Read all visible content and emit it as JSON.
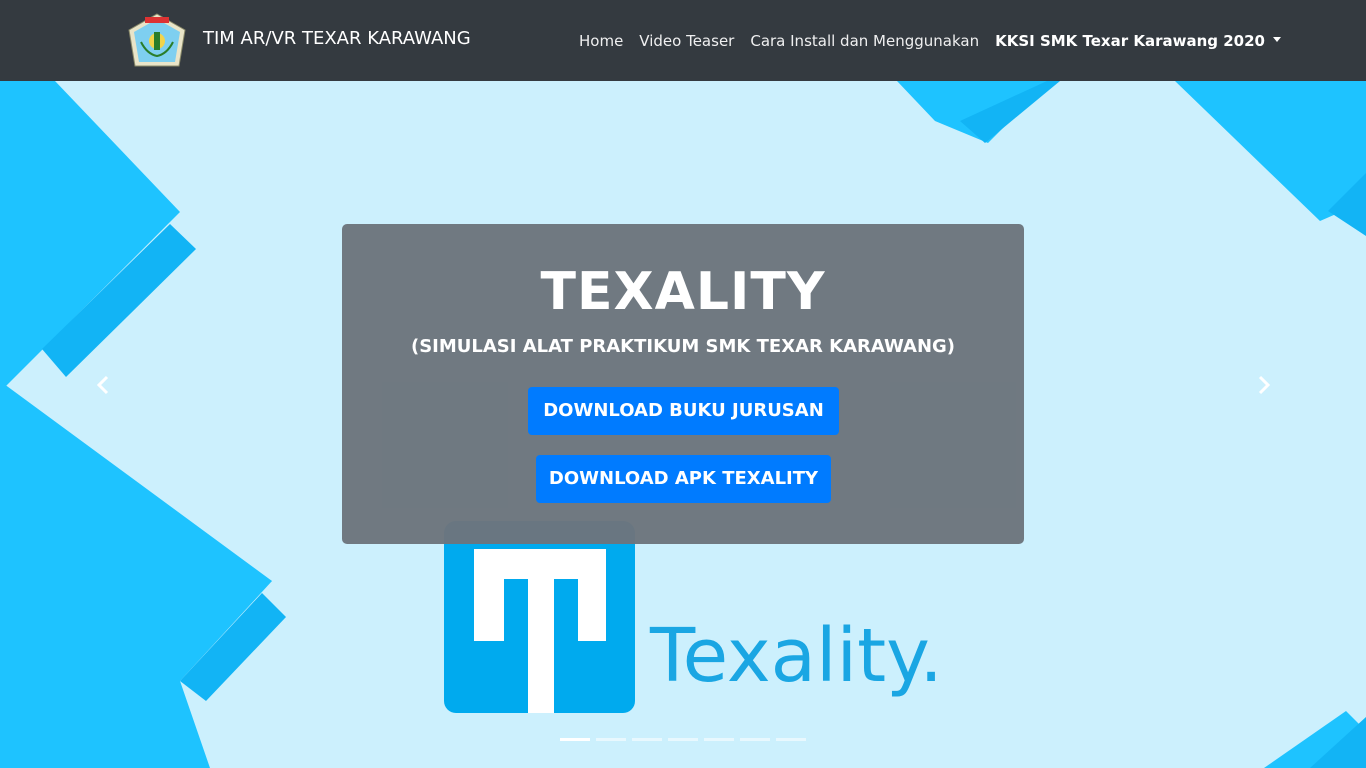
{
  "navbar": {
    "brand": "TIM AR/VR TEXAR KARAWANG",
    "logo_icon": "school-emblem-icon",
    "links": [
      {
        "label": "Home"
      },
      {
        "label": "Video Teaser"
      },
      {
        "label": "Cara Install dan Menggunakan"
      }
    ],
    "dropdown": {
      "label": "KKSI SMK Texar Karawang 2020"
    }
  },
  "hero": {
    "title": "TEXALITY",
    "subtitle": "(SIMULASI ALAT PRAKTIKUM SMK TEXAR KARAWANG)",
    "buttons": {
      "buku": "DOWNLOAD BUKU JURUSAN",
      "apk": "DOWNLOAD APK TEXALITY"
    },
    "logo_word": "Texality.",
    "active_slide": 1,
    "slide_count": 7
  },
  "colors": {
    "navbar": "#343a40",
    "hero_bg": "#ccf0fd",
    "accent_blue": "#1ec3ff",
    "button": "#007bff",
    "panel": "#6c757d",
    "logo_square": "#00aaee"
  }
}
